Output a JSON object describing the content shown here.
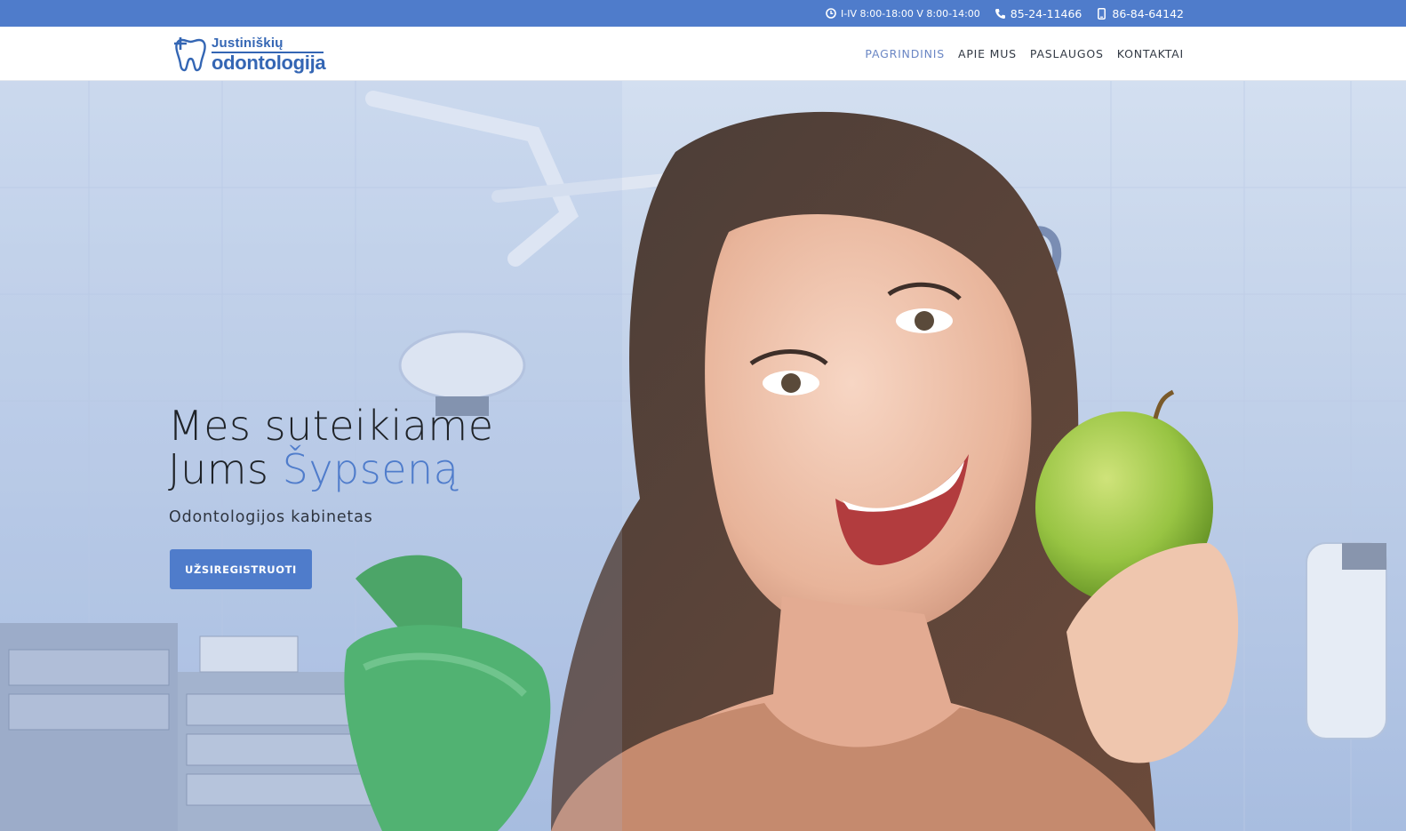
{
  "topbar": {
    "hours": "I-IV 8:00-18:00 V 8:00-14:00",
    "phone": "85-24-11466",
    "mobile": "86-84-64142",
    "icons": {
      "hours": "clock-icon",
      "phone": "phone-icon",
      "mobile": "mobile-icon"
    },
    "bg_color": "#4f7ccb"
  },
  "logo": {
    "line1": "Justiniškių",
    "line2": "odontologija",
    "color": "#3466b4"
  },
  "nav": {
    "items": [
      {
        "label": "PAGRINDINIS",
        "active": true
      },
      {
        "label": "APIE MUS",
        "active": false
      },
      {
        "label": "PASLAUGOS",
        "active": false
      },
      {
        "label": "KONTAKTAI",
        "active": false
      }
    ],
    "active_color": "#6a86c4"
  },
  "hero": {
    "title_line1": "Mes suteikiame",
    "title_line2_plain": "Jums ",
    "title_line2_accent": "Šypseną",
    "subtitle": "Odontologijos kabinetas",
    "cta_label": "UŽSIREGISTRUOTI",
    "accent_color": "#4f7ccb"
  }
}
